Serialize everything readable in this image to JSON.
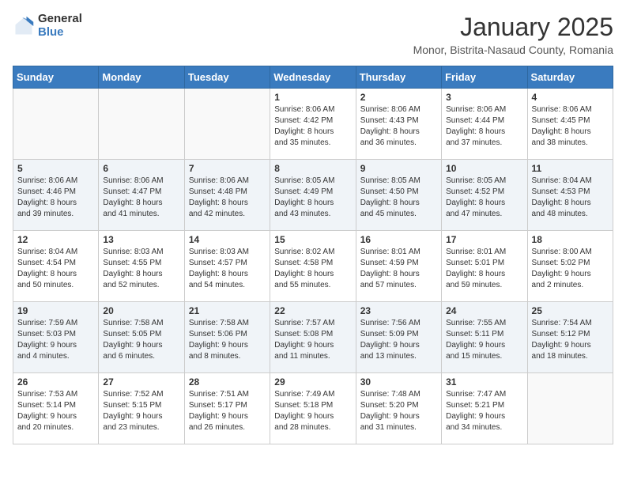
{
  "logo": {
    "general": "General",
    "blue": "Blue"
  },
  "title": "January 2025",
  "location": "Monor, Bistrita-Nasaud County, Romania",
  "days_header": [
    "Sunday",
    "Monday",
    "Tuesday",
    "Wednesday",
    "Thursday",
    "Friday",
    "Saturday"
  ],
  "weeks": [
    [
      {
        "day": "",
        "info": ""
      },
      {
        "day": "",
        "info": ""
      },
      {
        "day": "",
        "info": ""
      },
      {
        "day": "1",
        "info": "Sunrise: 8:06 AM\nSunset: 4:42 PM\nDaylight: 8 hours\nand 35 minutes."
      },
      {
        "day": "2",
        "info": "Sunrise: 8:06 AM\nSunset: 4:43 PM\nDaylight: 8 hours\nand 36 minutes."
      },
      {
        "day": "3",
        "info": "Sunrise: 8:06 AM\nSunset: 4:44 PM\nDaylight: 8 hours\nand 37 minutes."
      },
      {
        "day": "4",
        "info": "Sunrise: 8:06 AM\nSunset: 4:45 PM\nDaylight: 8 hours\nand 38 minutes."
      }
    ],
    [
      {
        "day": "5",
        "info": "Sunrise: 8:06 AM\nSunset: 4:46 PM\nDaylight: 8 hours\nand 39 minutes."
      },
      {
        "day": "6",
        "info": "Sunrise: 8:06 AM\nSunset: 4:47 PM\nDaylight: 8 hours\nand 41 minutes."
      },
      {
        "day": "7",
        "info": "Sunrise: 8:06 AM\nSunset: 4:48 PM\nDaylight: 8 hours\nand 42 minutes."
      },
      {
        "day": "8",
        "info": "Sunrise: 8:05 AM\nSunset: 4:49 PM\nDaylight: 8 hours\nand 43 minutes."
      },
      {
        "day": "9",
        "info": "Sunrise: 8:05 AM\nSunset: 4:50 PM\nDaylight: 8 hours\nand 45 minutes."
      },
      {
        "day": "10",
        "info": "Sunrise: 8:05 AM\nSunset: 4:52 PM\nDaylight: 8 hours\nand 47 minutes."
      },
      {
        "day": "11",
        "info": "Sunrise: 8:04 AM\nSunset: 4:53 PM\nDaylight: 8 hours\nand 48 minutes."
      }
    ],
    [
      {
        "day": "12",
        "info": "Sunrise: 8:04 AM\nSunset: 4:54 PM\nDaylight: 8 hours\nand 50 minutes."
      },
      {
        "day": "13",
        "info": "Sunrise: 8:03 AM\nSunset: 4:55 PM\nDaylight: 8 hours\nand 52 minutes."
      },
      {
        "day": "14",
        "info": "Sunrise: 8:03 AM\nSunset: 4:57 PM\nDaylight: 8 hours\nand 54 minutes."
      },
      {
        "day": "15",
        "info": "Sunrise: 8:02 AM\nSunset: 4:58 PM\nDaylight: 8 hours\nand 55 minutes."
      },
      {
        "day": "16",
        "info": "Sunrise: 8:01 AM\nSunset: 4:59 PM\nDaylight: 8 hours\nand 57 minutes."
      },
      {
        "day": "17",
        "info": "Sunrise: 8:01 AM\nSunset: 5:01 PM\nDaylight: 8 hours\nand 59 minutes."
      },
      {
        "day": "18",
        "info": "Sunrise: 8:00 AM\nSunset: 5:02 PM\nDaylight: 9 hours\nand 2 minutes."
      }
    ],
    [
      {
        "day": "19",
        "info": "Sunrise: 7:59 AM\nSunset: 5:03 PM\nDaylight: 9 hours\nand 4 minutes."
      },
      {
        "day": "20",
        "info": "Sunrise: 7:58 AM\nSunset: 5:05 PM\nDaylight: 9 hours\nand 6 minutes."
      },
      {
        "day": "21",
        "info": "Sunrise: 7:58 AM\nSunset: 5:06 PM\nDaylight: 9 hours\nand 8 minutes."
      },
      {
        "day": "22",
        "info": "Sunrise: 7:57 AM\nSunset: 5:08 PM\nDaylight: 9 hours\nand 11 minutes."
      },
      {
        "day": "23",
        "info": "Sunrise: 7:56 AM\nSunset: 5:09 PM\nDaylight: 9 hours\nand 13 minutes."
      },
      {
        "day": "24",
        "info": "Sunrise: 7:55 AM\nSunset: 5:11 PM\nDaylight: 9 hours\nand 15 minutes."
      },
      {
        "day": "25",
        "info": "Sunrise: 7:54 AM\nSunset: 5:12 PM\nDaylight: 9 hours\nand 18 minutes."
      }
    ],
    [
      {
        "day": "26",
        "info": "Sunrise: 7:53 AM\nSunset: 5:14 PM\nDaylight: 9 hours\nand 20 minutes."
      },
      {
        "day": "27",
        "info": "Sunrise: 7:52 AM\nSunset: 5:15 PM\nDaylight: 9 hours\nand 23 minutes."
      },
      {
        "day": "28",
        "info": "Sunrise: 7:51 AM\nSunset: 5:17 PM\nDaylight: 9 hours\nand 26 minutes."
      },
      {
        "day": "29",
        "info": "Sunrise: 7:49 AM\nSunset: 5:18 PM\nDaylight: 9 hours\nand 28 minutes."
      },
      {
        "day": "30",
        "info": "Sunrise: 7:48 AM\nSunset: 5:20 PM\nDaylight: 9 hours\nand 31 minutes."
      },
      {
        "day": "31",
        "info": "Sunrise: 7:47 AM\nSunset: 5:21 PM\nDaylight: 9 hours\nand 34 minutes."
      },
      {
        "day": "",
        "info": ""
      }
    ]
  ]
}
